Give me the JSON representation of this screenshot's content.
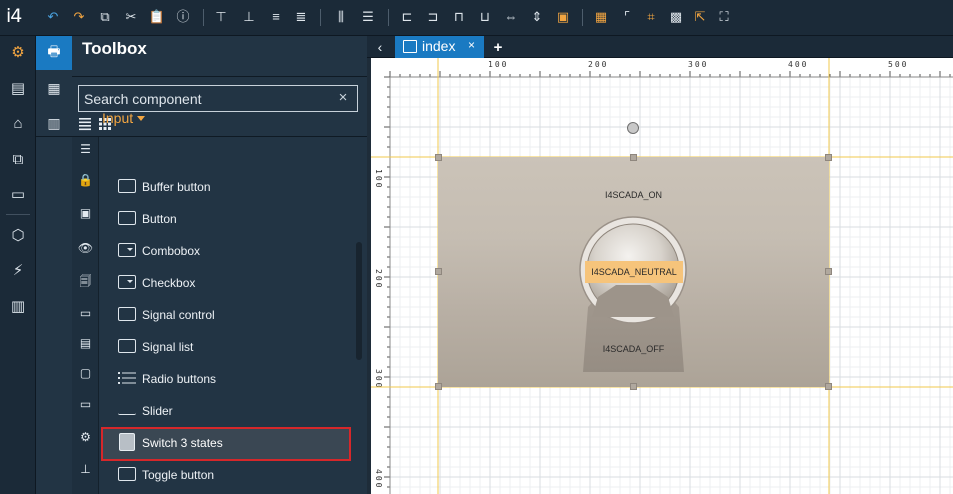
{
  "app": {
    "logo": "i4"
  },
  "toolbar": {
    "icons": [
      "undo-icon",
      "redo-icon",
      "copy-icon",
      "cut-icon",
      "paste-icon",
      "info-icon",
      "align-top-icon",
      "align-bottom-icon",
      "align-middle-icon",
      "distribute-icon",
      "align-vertical-center-icon",
      "align-horizontal-center-icon",
      "align-left-icon",
      "align-right-icon",
      "align-top-edge-icon",
      "align-bottom-edge-icon",
      "same-width-icon",
      "same-height-icon",
      "same-size-icon",
      "grid-icon",
      "snap-icon",
      "resize-icon",
      "select-all-icon",
      "pointer-icon",
      "fit-icon"
    ]
  },
  "rail": {
    "items": [
      "settings-icon",
      "editor-icon",
      "layers-icon",
      "pages-icon",
      "monitor-icon",
      "package-icon",
      "signal-icon",
      "archive-icon"
    ],
    "active": "settings-icon"
  },
  "toolbox": {
    "title": "Toolbox",
    "search_placeholder": "Search component",
    "clear_symbol": "×",
    "group": "Input",
    "categories": [
      "general-icon",
      "lock-icon",
      "chart-icon",
      "eye-icon",
      "report-icon",
      "display-icon",
      "list-icon",
      "window-icon",
      "media-icon",
      "gears-icon",
      "valve-icon"
    ],
    "components": [
      {
        "label": "Buffer button",
        "icon": "button-icon"
      },
      {
        "label": "Button",
        "icon": "button-icon"
      },
      {
        "label": "Combobox",
        "icon": "combobox-icon"
      },
      {
        "label": "Checkbox",
        "icon": "combobox-icon"
      },
      {
        "label": "Signal control",
        "icon": "signal-control-icon"
      },
      {
        "label": "Signal list",
        "icon": "signal-list-icon"
      },
      {
        "label": "Radio buttons",
        "icon": "radio-buttons-icon"
      },
      {
        "label": "Slider",
        "icon": "slider-icon"
      },
      {
        "label": "Switch 3 states",
        "icon": "switch-icon",
        "highlighted": true
      },
      {
        "label": "Toggle button",
        "icon": "button-icon"
      }
    ]
  },
  "tabs": {
    "back": "‹",
    "active_tab": "index",
    "close": "×",
    "add": "+"
  },
  "ruler": {
    "top_labels": [
      "100",
      "200",
      "300",
      "400",
      "500"
    ],
    "left_labels": [
      "100",
      "200",
      "300",
      "400"
    ]
  },
  "widget": {
    "on_label": "I4SCADA_ON",
    "neutral_label": "I4SCADA_NEUTRAL",
    "off_label": "I4SCADA_OFF"
  },
  "colors": {
    "accent": "#1a7ac2",
    "group": "#f2a541",
    "highlight_border": "#d6272a",
    "neutral_bg": "#f6c47b"
  }
}
